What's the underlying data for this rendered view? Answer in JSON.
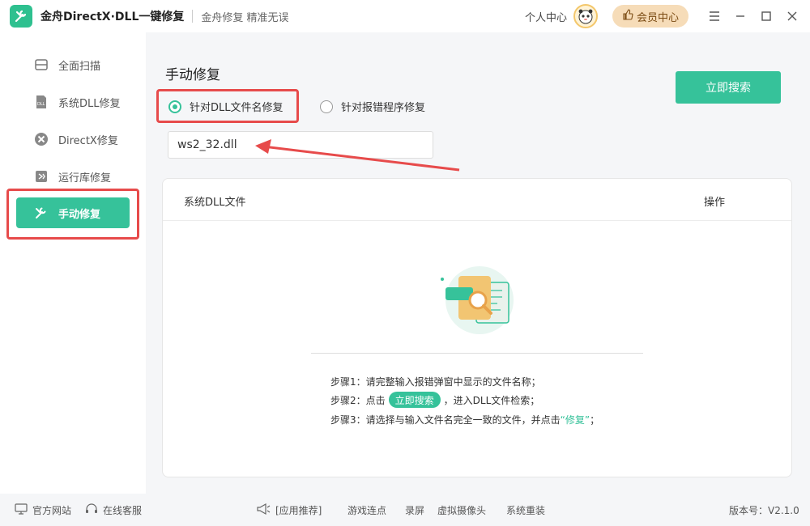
{
  "titlebar": {
    "app_title": "金舟DirectX·DLL一键修复",
    "subtitle": "金舟修复 精准无误",
    "user_center": "个人中心",
    "vip_label": "会员中心"
  },
  "sidebar": {
    "items": [
      {
        "label": "全面扫描",
        "icon": "scan-icon"
      },
      {
        "label": "系统DLL修复",
        "icon": "dll-icon"
      },
      {
        "label": "DirectX修复",
        "icon": "directx-icon"
      },
      {
        "label": "运行库修复",
        "icon": "runtime-icon"
      },
      {
        "label": "手动修复",
        "icon": "wrench-icon",
        "active": true
      }
    ]
  },
  "main": {
    "title": "手动修复",
    "radio_by_dll": "针对DLL文件名修复",
    "radio_by_program": "针对报错程序修复",
    "search_button": "立即搜索",
    "dll_input_value": "ws2_32.dll",
    "table": {
      "col_name": "系统DLL文件",
      "col_action": "操作"
    },
    "steps": {
      "step1": "步骤1：请完整输入报错弹窗中显示的文件名称；",
      "step2_prefix": "步骤2：点击",
      "step2_pill": "立即搜索",
      "step2_suffix": "，进入DLL文件检索；",
      "step3_prefix": "步骤3：请选择与输入文件名完全一致的文件，并点击",
      "step3_highlight": "“修复”",
      "step3_suffix": "；"
    }
  },
  "footer": {
    "official_site": "官方网站",
    "online_service": "在线客服",
    "app_recommend": "[应用推荐]",
    "links": [
      "游戏连点",
      "录屏",
      "虚拟摄像头",
      "系统重装"
    ],
    "version": "版本号：V2.1.0"
  },
  "colors": {
    "accent": "#36c29a",
    "highlight_box": "#e74b4b",
    "vip_bg": "#f6dcb8"
  }
}
